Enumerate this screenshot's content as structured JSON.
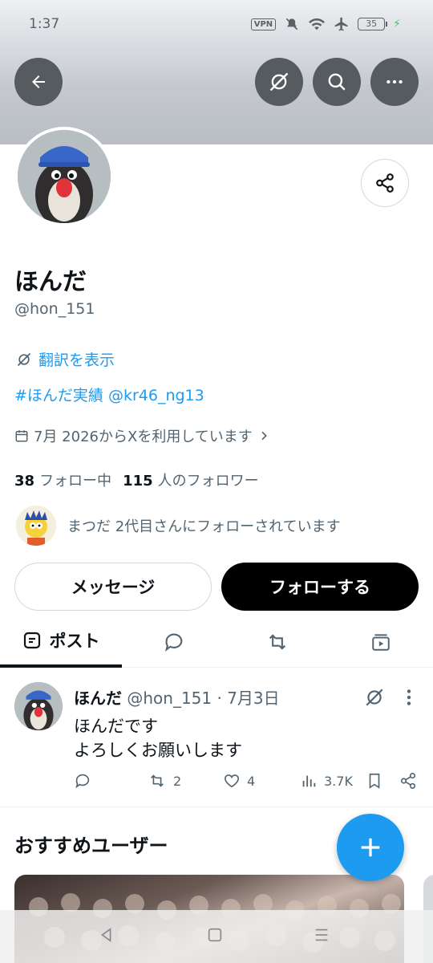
{
  "status_bar": {
    "time": "1:37",
    "vpn": "VPN",
    "battery": "35"
  },
  "profile": {
    "name": "ほんだ",
    "handle": "@hon_151",
    "translate_label": "翻訳を表示",
    "bio": "#ほんだ実績 @kr46_ng13",
    "joined": "7月 2026からXを利用しています",
    "following_count": "38",
    "following_label": "フォロー中",
    "followers_count": "115",
    "followers_label": "人のフォロワー",
    "followed_by": "まつだ 2代目さんにフォローされています"
  },
  "actions": {
    "message_label": "メッセージ",
    "follow_label": "フォローする"
  },
  "tabs": [
    {
      "label": "ポスト",
      "icon": "post-icon"
    },
    {
      "icon": "reply-icon"
    },
    {
      "icon": "retweet-icon"
    },
    {
      "icon": "media-icon"
    }
  ],
  "post": {
    "name": "ほんだ",
    "handle_date": "@hon_151 · 7月3日",
    "line1": "ほんだです",
    "line2": "よろしくお願いします",
    "retweets": "2",
    "likes": "4",
    "views": "3.7K"
  },
  "recommendations": {
    "title": "おすすめユーザー"
  },
  "colors": {
    "accent": "#1d9bf0",
    "text": "#0f1419",
    "secondary": "#536471"
  }
}
